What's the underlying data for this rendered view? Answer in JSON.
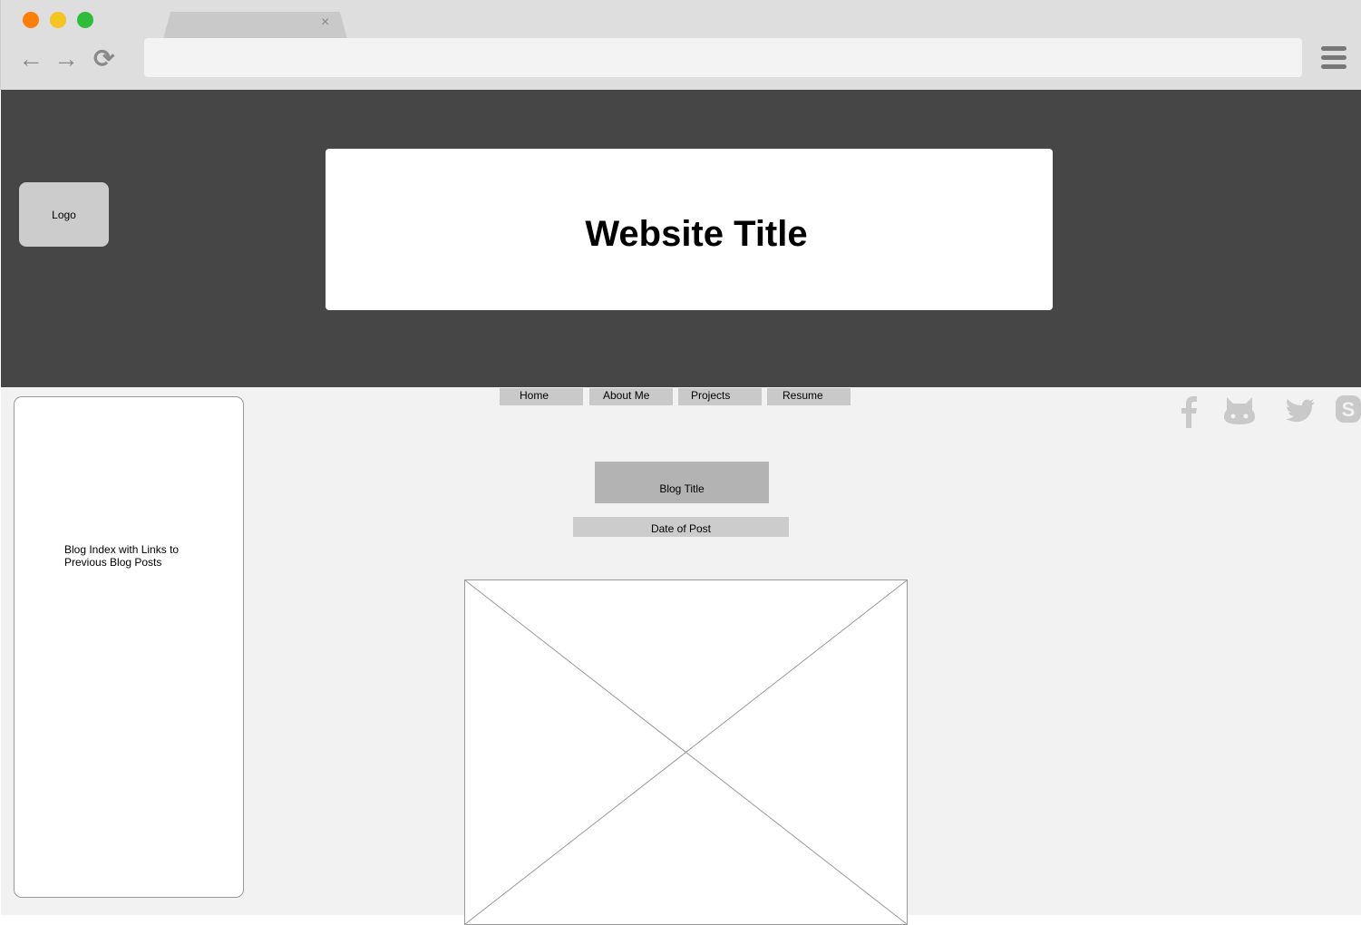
{
  "browser": {
    "tab_close": "×",
    "back_icon": "←",
    "forward_icon": "→",
    "reload_icon": "⟳",
    "traffic_lights": [
      "#fd7e08",
      "#f3c422",
      "#30bc3b"
    ]
  },
  "header": {
    "logo": "Logo",
    "title": "Website Title"
  },
  "nav": [
    "Home",
    "About Me",
    "Projects",
    "Resume"
  ],
  "sidebar": {
    "text": "Blog Index with Links to Previous Blog Posts"
  },
  "post": {
    "title": "Blog Title",
    "date": "Date of Post"
  },
  "social": [
    "facebook-icon",
    "github-icon",
    "twitter-icon",
    "skype-icon"
  ]
}
